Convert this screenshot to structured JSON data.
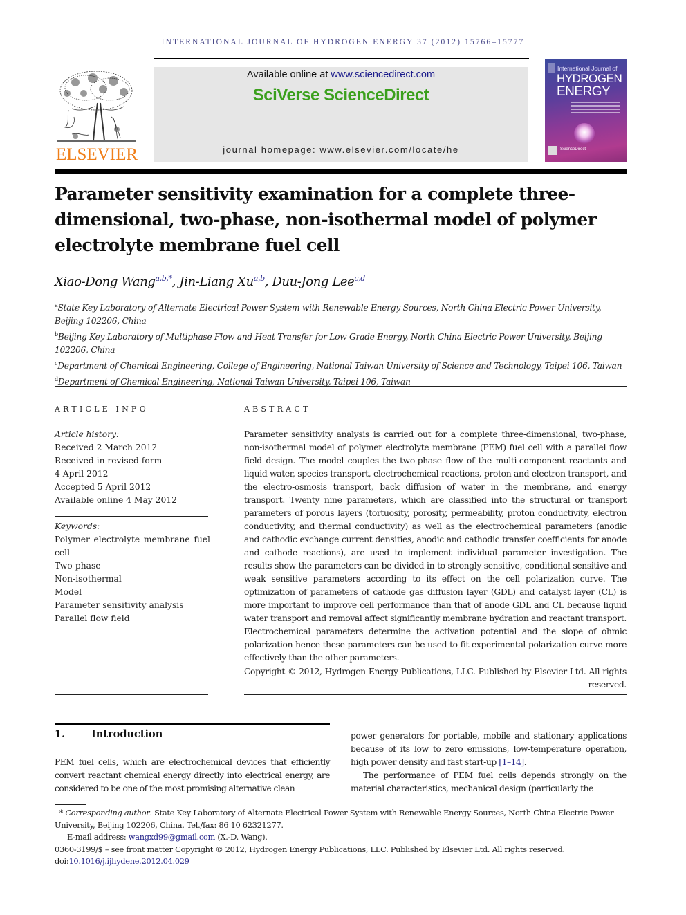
{
  "running_head": "INTERNATIONAL JOURNAL OF HYDROGEN ENERGY 37 (2012) 15766–15777",
  "masthead": {
    "publisher_logo": "ELSEVIER",
    "available_prefix": "Available online at ",
    "available_link": "www.sciencedirect.com",
    "brand": "SciVerse ScienceDirect",
    "homepage_prefix": "journal homepage: ",
    "homepage_url": "www.elsevier.com/locate/he",
    "cover": {
      "line1": "International Journal of",
      "line2": "HYDROGEN",
      "line3": "ENERGY",
      "sd_label": "ScienceDirect"
    },
    "colors": {
      "elsevier_orange": "#f07f19",
      "sd_green": "#3ba01d",
      "link_blue": "#2a2a8c"
    }
  },
  "article": {
    "title": "Parameter sensitivity examination for a complete three-dimensional, two-phase, non-isothermal model of polymer electrolyte membrane fuel cell",
    "authors": [
      {
        "name": "Xiao-Dong Wang",
        "sup": "a,b,*"
      },
      {
        "name": "Jin-Liang Xu",
        "sup": "a,b"
      },
      {
        "name": "Duu-Jong Lee",
        "sup": "c,d"
      }
    ],
    "affiliations": [
      {
        "key": "a",
        "text": "State Key Laboratory of Alternate Electrical Power System with Renewable Energy Sources, North China Electric Power University, Beijing 102206, China"
      },
      {
        "key": "b",
        "text": "Beijing Key Laboratory of Multiphase Flow and Heat Transfer for Low Grade Energy, North China Electric Power University, Beijing 102206, China"
      },
      {
        "key": "c",
        "text": "Department of Chemical Engineering, College of Engineering, National Taiwan University of Science and Technology, Taipei 106, Taiwan"
      },
      {
        "key": "d",
        "text": "Department of Chemical Engineering, National Taiwan University, Taipei 106, Taiwan"
      }
    ]
  },
  "article_info": {
    "heading": "ARTICLE INFO",
    "history_label": "Article history:",
    "history": [
      "Received 2 March 2012",
      "Received in revised form",
      "4 April 2012",
      "Accepted 5 April 2012",
      "Available online 4 May 2012"
    ],
    "keywords_label": "Keywords:",
    "keywords": [
      "Polymer electrolyte membrane fuel",
      "cell",
      "Two-phase",
      "Non-isothermal",
      "Model",
      "Parameter sensitivity analysis",
      "Parallel flow field"
    ]
  },
  "abstract": {
    "heading": "ABSTRACT",
    "text": "Parameter sensitivity analysis is carried out for a complete three-dimensional, two-phase, non-isothermal model of polymer electrolyte membrane (PEM) fuel cell with a parallel flow field design. The model couples the two-phase flow of the multi-component reactants and liquid water, species transport, electrochemical reactions, proton and electron transport, and the electro-osmosis transport, back diffusion of water in the membrane, and energy transport. Twenty nine parameters, which are classified into the structural or transport parameters of porous layers (tortuosity, porosity, permeability, proton conductivity, elec­tron conductivity, and thermal conductivity) as well as the electrochemical parameters (anodic and cathodic exchange current densities, anodic and cathodic transfer coefficients for anode and cathode reactions), are used to implement individual parameter investiga­tion. The results show the parameters can be divided in to strongly sensitive, conditional sensitive and weak sensitive parameters according to its effect on the cell polarization curve. The optimization of parameters of cathode gas diffusion layer (GDL) and catalyst layer (CL) is more important to improve cell performance than that of anode GDL and CL because liquid water transport and removal affect significantly membrane hydration and reactant transport. Electrochemical parameters determine the activation potential and the slope of ohmic polarization hence these parameters can be used to fit experimental polarization curve more effectively than the other parameters.",
    "copyright": "Copyright © 2012, Hydrogen Energy Publications, LLC. Published by Elsevier Ltd. All rights reserved."
  },
  "introduction": {
    "number": "1.",
    "heading": "Introduction",
    "left_text": "PEM fuel cells, which are electrochemical devices that efficiently convert reactant chemical energy directly into electrical energy, are considered to be one of the most promising alternative clean",
    "right_p1_text": "power generators for portable, mobile and stationary applica­tions because of its low to zero emissions, low-temperature operation, high power density and fast start-up ",
    "right_p1_ref": "[1–14]",
    "right_p1_end": ".",
    "right_p2": "The performance of PEM fuel cells depends strongly on the material characteristics, mechanical design (particularly the"
  },
  "footnotes": {
    "corr_star": "*",
    "corr_label": "Corresponding author",
    "corr_text": ". State Key Laboratory of Alternate Electrical Power System with Renewable Energy Sources, North China Electric Power University, Beijing 102206, China. Tel./fax: 86 10 62321277.",
    "email_label": "E-mail address: ",
    "email": "wangxd99@gmail.com",
    "email_suffix": " (X.-D. Wang).",
    "front_matter": "0360-3199/$ – see front matter Copyright © 2012, Hydrogen Energy Publications, LLC. Published by Elsevier Ltd. All rights reserved.",
    "doi_prefix": "doi:",
    "doi": "10.1016/j.ijhydene.2012.04.029"
  }
}
